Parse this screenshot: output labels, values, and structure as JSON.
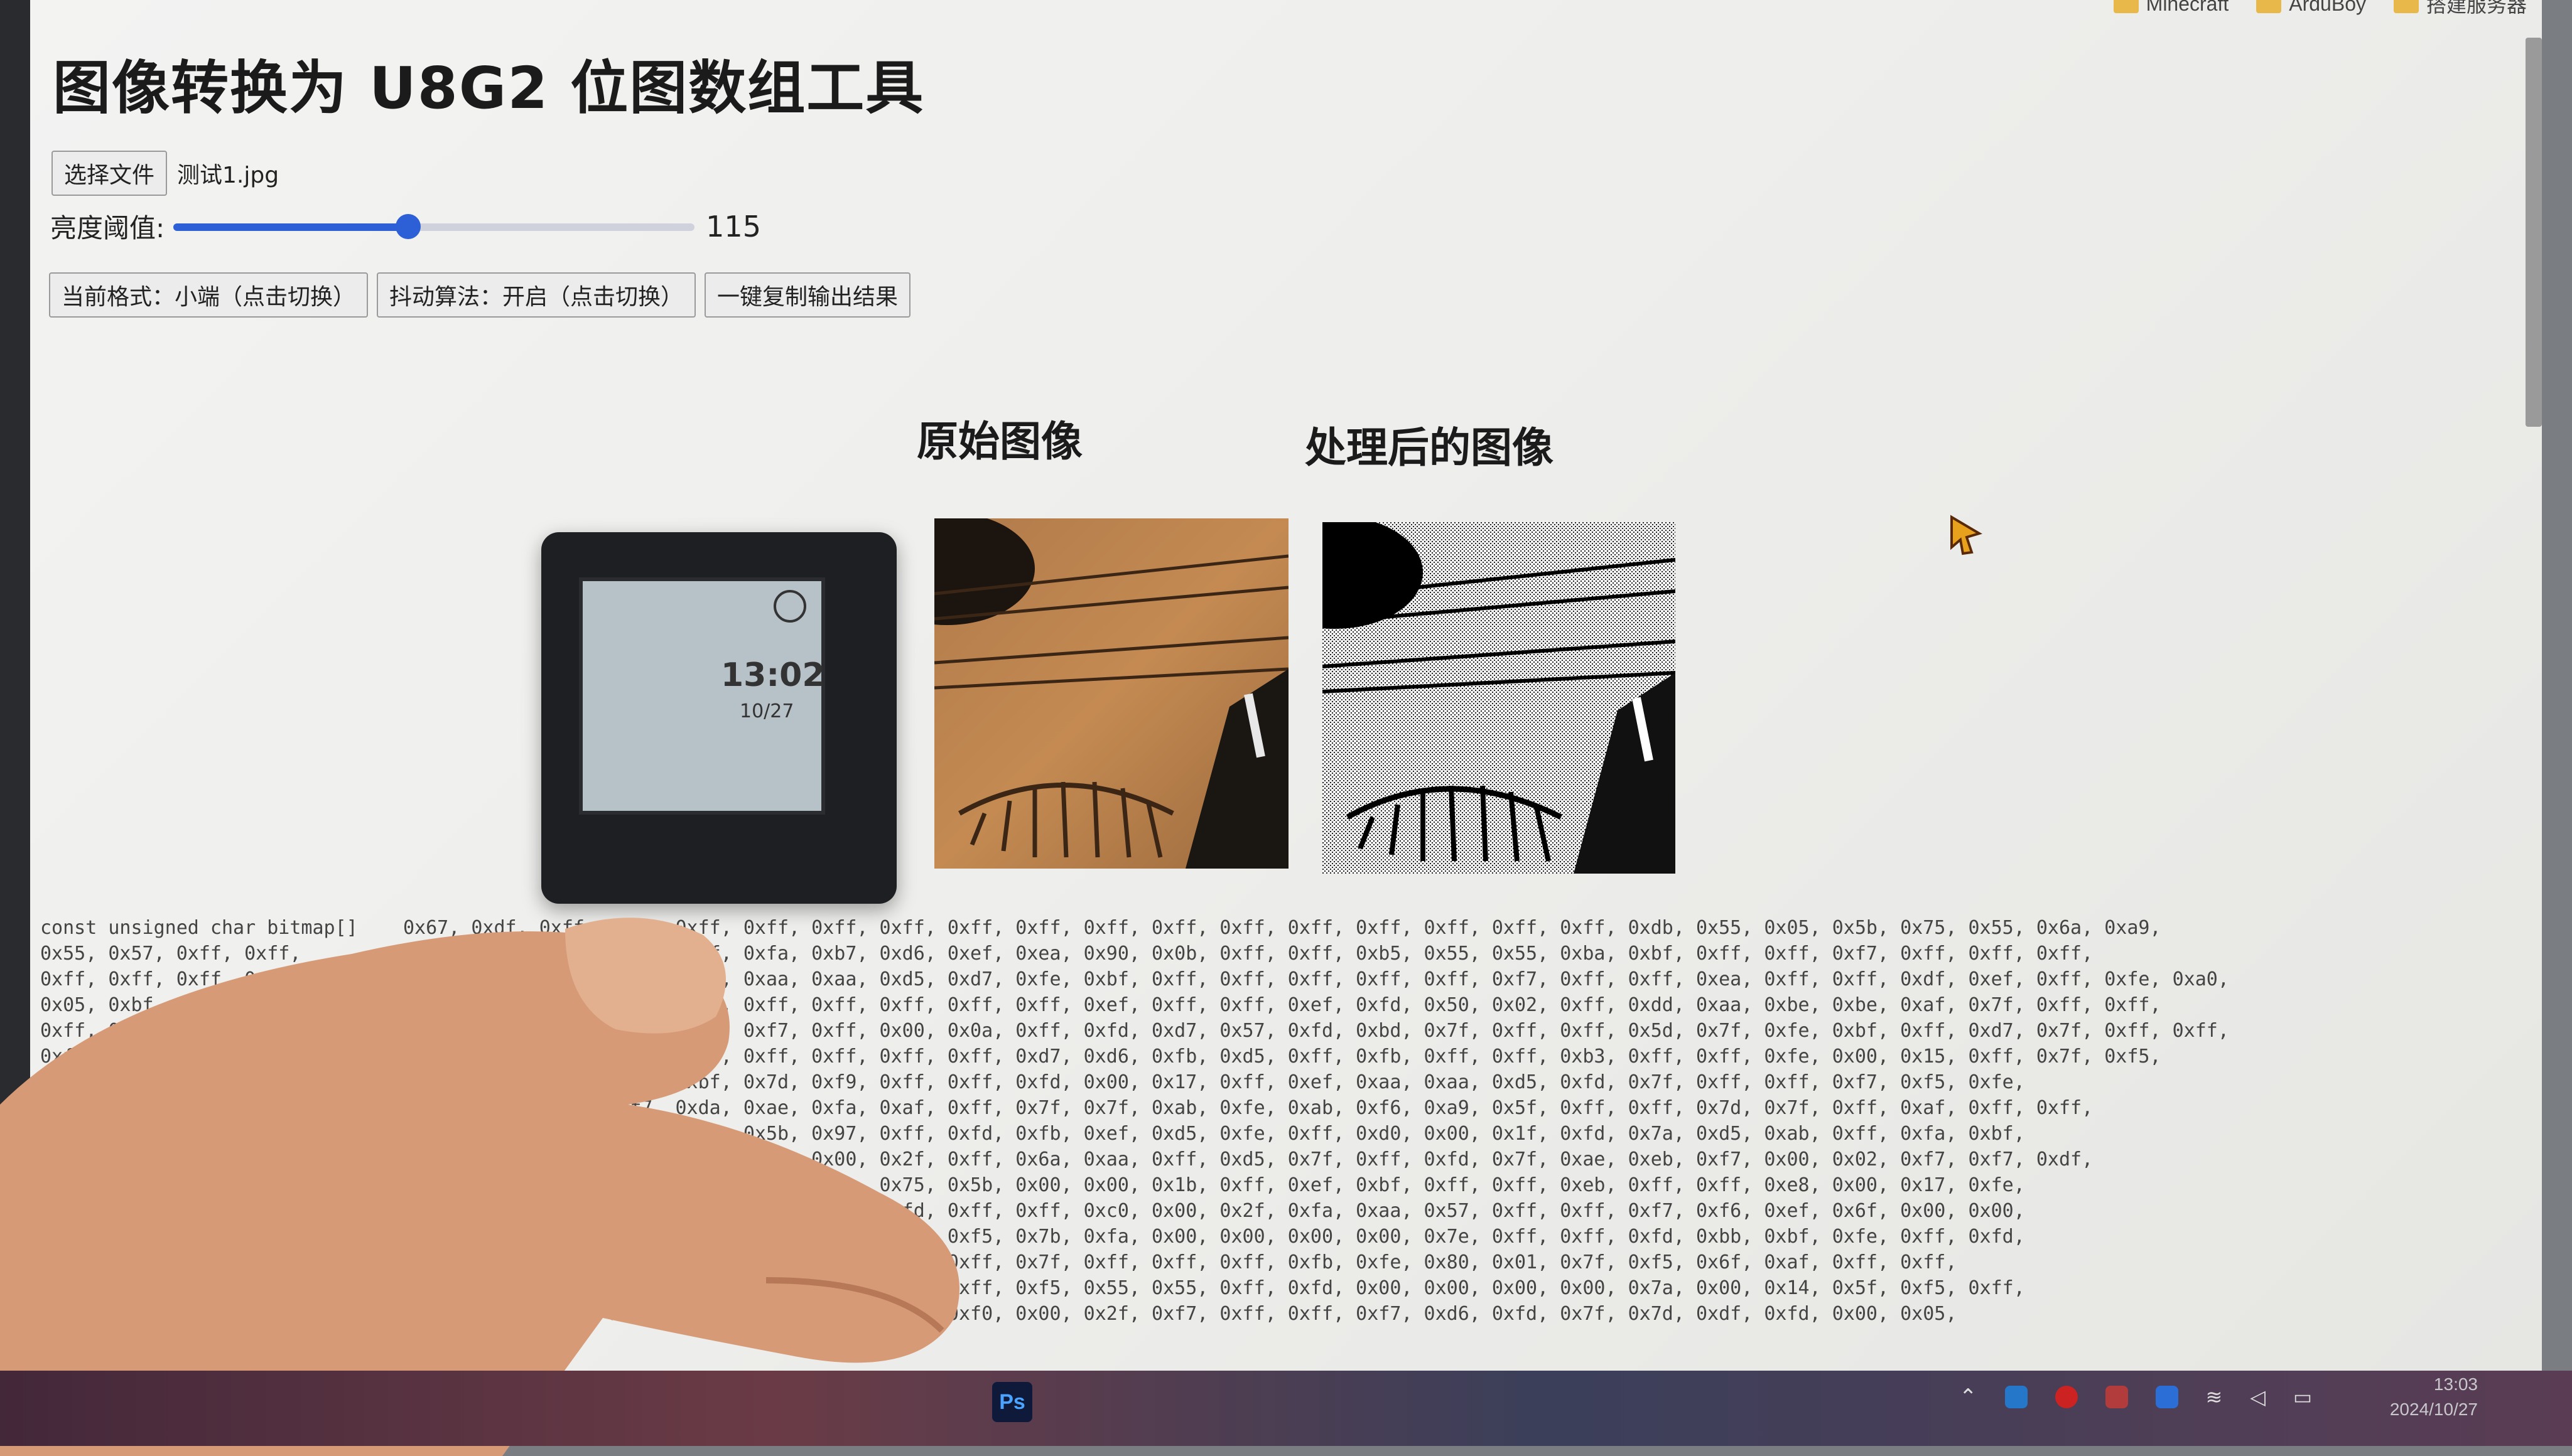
{
  "bookmarks": [
    "Minecraft",
    "ArduBoy",
    "搭建服务器"
  ],
  "page_title": "图像转换为 U8G2 位图数组工具",
  "file": {
    "button_label": "选择文件",
    "file_name": "测试1.jpg"
  },
  "threshold": {
    "label": "亮度阈值:",
    "value": "115",
    "fraction": 0.45
  },
  "buttons": {
    "format": "当前格式：小端（点击切换）",
    "dither": "抖动算法：开启（点击切换）",
    "copy": "一键复制输出结果"
  },
  "images": {
    "original_title": "原始图像",
    "processed_title": "处理后的图像"
  },
  "device": {
    "time": "13:02",
    "date": "10/27"
  },
  "code_lines": [
    "const unsigned char bitmap[]    0x67, 0xdf, 0xff, 0xff, 0xff, 0xff, 0xff, 0xff, 0xff, 0xff, 0xff, 0xff, 0xff, 0xff, 0xff, 0xff, 0xff, 0xff, 0xdb, 0x55, 0x05, 0x5b, 0x75, 0x55, 0x6a, 0xa9,",
    "0x55, 0x57, 0xff, 0xff,                     0xff, 0xff, 0xff, 0xfa, 0xb7, 0xd6, 0xef, 0xea, 0x90, 0x0b, 0xff, 0xff, 0xb5, 0x55, 0x55, 0xba, 0xbf, 0xff, 0xff, 0xf7, 0xff, 0xff, 0xff,",
    "0xff, 0xff, 0xff, 0xff,                     0x05, 0x7f, 0xfd, 0xaa, 0xaa, 0xd5, 0xd7, 0xfe, 0xbf, 0xff, 0xff, 0xff, 0xff, 0xff, 0xf7, 0xff, 0xff, 0xea, 0xff, 0xff, 0xdf, 0xef, 0xff, 0xfe, 0xa0,",
    "0x05, 0xbf, 0xff,                           0xf7, 0xff, 0xff, 0xff, 0xff, 0xff, 0xff, 0xff, 0xef, 0xff, 0xff, 0xef, 0xfd, 0x50, 0x02, 0xff, 0xdd, 0xaa, 0xbe, 0xbe, 0xaf, 0x7f, 0xff, 0xff,",
    "0xff, 0xfd,                                 0xff, 0xff, 0xff, 0xf7, 0xff, 0x00, 0x0a, 0xff, 0xfd, 0xd7, 0x57, 0xfd, 0xbd, 0x7f, 0xff, 0xff, 0x5d, 0x7f, 0xfe, 0xbf, 0xff, 0xd7, 0x7f, 0xff, 0xff,",
    "0xff,                                       0xb5, 0x7f, 0xff, 0xff, 0xff, 0xff, 0xff, 0xd7, 0xd6, 0xfb, 0xd5, 0xff, 0xfb, 0xff, 0xff, 0xb3, 0xff, 0xff, 0xfe, 0x00, 0x15, 0xff, 0x7f, 0xf5,",
    "0x6b,                                       0xbf, 0xff, 0xbf, 0x7d, 0xf9, 0xff, 0xff, 0xfd, 0x00, 0x17, 0xff, 0xef, 0xaa, 0xaa, 0xd5, 0xfd, 0x7f, 0xff, 0xff, 0xf7, 0xf5, 0xfe,",
    "0x                                          0xff, 0xf7, 0xda, 0xae, 0xfa, 0xaf, 0xff, 0x7f, 0x7f, 0xab, 0xfe, 0xab, 0xf6, 0xa9, 0x5f, 0xff, 0xff, 0x7d, 0x7f, 0xff, 0xaf, 0xff, 0xff,",
    "                                            0xfe, 0xab, 0xad, 0x5b, 0x97, 0xff, 0xfd, 0xfb, 0xef, 0xd5, 0xfe, 0xff, 0xd0, 0x00, 0x1f, 0xfd, 0x7a, 0xd5, 0xab, 0xff, 0xfa, 0xbf,",
    "                                            0xff, 0xfe, 0xfd, 0xf0, 0x00, 0x2f, 0xff, 0x6a, 0xaa, 0xff, 0xd5, 0x7f, 0xff, 0xfd, 0x7f, 0xae, 0xeb, 0xf7, 0x00, 0x02, 0xf7, 0xf7, 0xdf,",
    "                                            0xaf, 0xff, 0xff, 0xfd, 0xfb, 0x75, 0x5b, 0x00, 0x00, 0x1b, 0xff, 0xef, 0xbf, 0xff, 0xff, 0xeb, 0xff, 0xff, 0xe8, 0x00, 0x17, 0xfe,",
    "                                            0x7f, 0xf6, 0xef, 0xdf, 0xcf, 0xfd, 0xff, 0xff, 0xc0, 0x00, 0x2f, 0xfa, 0xaa, 0x57, 0xff, 0xff, 0xf7, 0xf6, 0xef, 0x6f, 0x00, 0x00,",
    "                                            0x1f, 0xfd, 0x6a, 0xaf, 0xff, 0xff, 0xf5, 0x7b, 0xfa, 0x00, 0x00, 0x00, 0x00, 0x7e, 0xff, 0xff, 0xfd, 0xbb, 0xbf, 0xfe, 0xff, 0xfd,",
    "                                            0x00, 0x00, 0x01, 0x7f, 0xff, 0xea, 0xff, 0x7f, 0xff, 0xff, 0xff, 0xfb, 0xfe, 0x80, 0x01, 0x7f, 0xf5, 0x6f, 0xaf, 0xff, 0xff,",
    "                                            0xff, 0xfe, 0xff, 0xfe, 0x80, 0x03, 0xff, 0xf5, 0x55, 0x55, 0xff, 0xfd, 0x00, 0x00, 0x00, 0x00, 0x7a, 0x00, 0x14, 0x5f, 0xf5, 0xff,",
    "                                            0xff, 0x00, 0x00, 0x00, 0x00, 0x1f, 0xf0, 0x00, 0x2f, 0xf7, 0xff, 0xff, 0xf7, 0xd6, 0xfd, 0x7f, 0x7d, 0xdf, 0xfd, 0x00, 0x05,"
  ],
  "taskbar": {
    "app": "Ps",
    "time": "13:03",
    "date": "2024/10/27"
  },
  "colors": {
    "accent": "#2d5fd7",
    "page_bg": "#f0f0ee"
  }
}
